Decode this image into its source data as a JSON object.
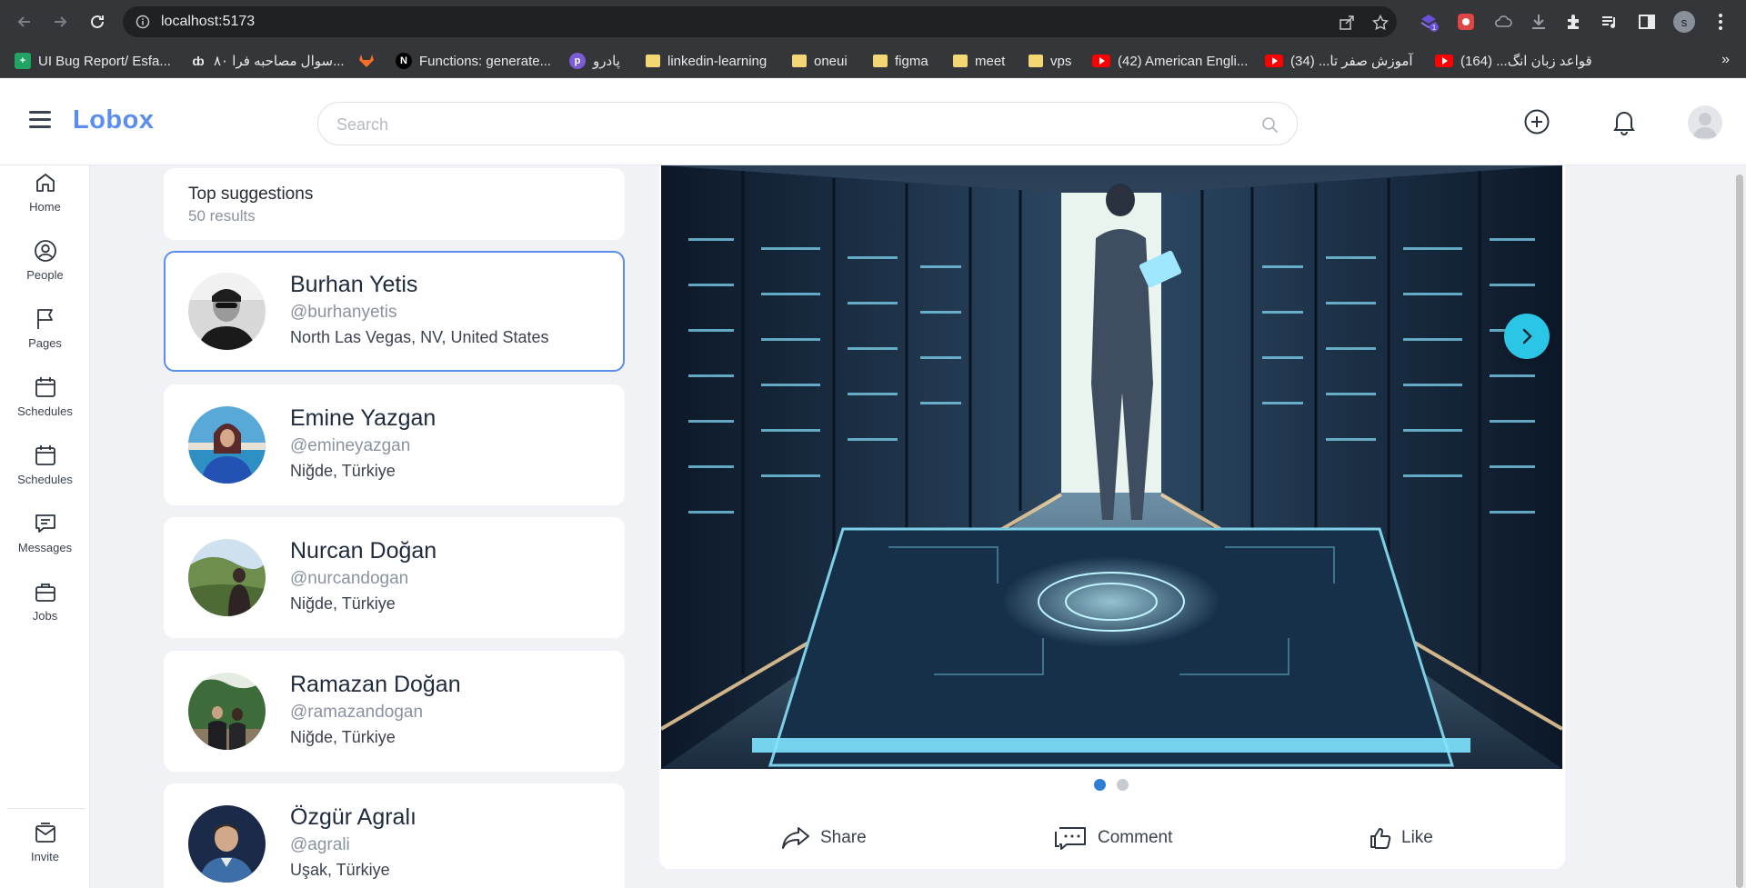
{
  "browser": {
    "url": "localhost:5173",
    "profile_initial": "s",
    "ext_badge": "1",
    "bookmarks": [
      {
        "label": "UI Bug Report/ Esfa...",
        "icon": "sheets-icon"
      },
      {
        "label": "۸۰ سوال مصاحبه فرا...",
        "icon": "notion-icon"
      },
      {
        "label": "",
        "icon": "gitlab-icon"
      },
      {
        "label": "Functions: generate...",
        "icon": "n-icon"
      },
      {
        "label": "پادرو",
        "icon": "padro-icon"
      },
      {
        "label": "linkedin-learning",
        "icon": "folder-icon"
      },
      {
        "label": "oneui",
        "icon": "folder-icon"
      },
      {
        "label": "figma",
        "icon": "folder-icon"
      },
      {
        "label": "meet",
        "icon": "folder-icon"
      },
      {
        "label": "vps",
        "icon": "folder-icon"
      },
      {
        "label": "(42) American Engli...",
        "icon": "youtube-icon"
      },
      {
        "label": "آموزش صفر تا... (34)",
        "icon": "youtube-icon"
      },
      {
        "label": "قواعد زبان انگ... (164)",
        "icon": "youtube-icon"
      }
    ],
    "more": "»"
  },
  "header": {
    "logo": "Lobox",
    "search_placeholder": "Search"
  },
  "leftnav": {
    "items": [
      {
        "label": "Home",
        "icon": "home-icon"
      },
      {
        "label": "People",
        "icon": "people-icon"
      },
      {
        "label": "Pages",
        "icon": "flag-icon"
      },
      {
        "label": "Schedules",
        "icon": "calendar-icon"
      },
      {
        "label": "Schedules",
        "icon": "calendar-icon"
      },
      {
        "label": "Messages",
        "icon": "message-icon"
      },
      {
        "label": "Jobs",
        "icon": "briefcase-icon"
      }
    ],
    "invite": "Invite"
  },
  "suggestions": {
    "title": "Top suggestions",
    "count": "50 results",
    "people": [
      {
        "name": "Burhan Yetis",
        "handle": "@burhanyetis",
        "location": "North Las Vegas, NV, United States"
      },
      {
        "name": "Emine Yazgan",
        "handle": "@emineyazgan",
        "location": "Niğde, Türkiye"
      },
      {
        "name": "Nurcan Doğan",
        "handle": "@nurcandogan",
        "location": "Niğde, Türkiye"
      },
      {
        "name": "Ramazan Doğan",
        "handle": "@ramazandogan",
        "location": "Niğde, Türkiye"
      },
      {
        "name": "Özgür Agralı",
        "handle": "@agrali",
        "location": "Uşak, Türkiye"
      }
    ]
  },
  "post": {
    "slide_count": 2,
    "active_slide": 1,
    "actions": {
      "share": "Share",
      "comment": "Comment",
      "like": "Like"
    }
  },
  "colors": {
    "brand": "#5a8dee",
    "next_button": "#2bc5e6",
    "active_dot": "#2e7dd7"
  }
}
